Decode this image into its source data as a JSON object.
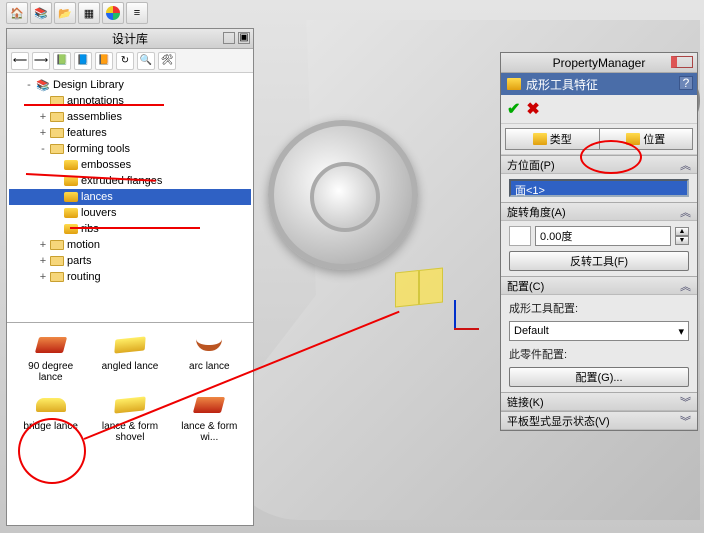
{
  "dl": {
    "title": "设计库",
    "root": "Design Library",
    "items": [
      {
        "indent": 1,
        "expand": "-",
        "icon": "lib",
        "label": "Design Library"
      },
      {
        "indent": 2,
        "expand": "",
        "icon": "fld",
        "label": "annotations"
      },
      {
        "indent": 2,
        "expand": "+",
        "icon": "fld",
        "label": "assemblies"
      },
      {
        "indent": 2,
        "expand": "+",
        "icon": "fld",
        "label": "features"
      },
      {
        "indent": 2,
        "expand": "-",
        "icon": "fld",
        "label": "forming tools"
      },
      {
        "indent": 3,
        "expand": "",
        "icon": "ft",
        "label": "embosses"
      },
      {
        "indent": 3,
        "expand": "",
        "icon": "ft",
        "label": "extruded flanges"
      },
      {
        "indent": 3,
        "expand": "",
        "icon": "ft",
        "label": "lances",
        "selected": true
      },
      {
        "indent": 3,
        "expand": "",
        "icon": "ft",
        "label": "louvers"
      },
      {
        "indent": 3,
        "expand": "",
        "icon": "ft",
        "label": "ribs"
      },
      {
        "indent": 2,
        "expand": "+",
        "icon": "fld",
        "label": "motion"
      },
      {
        "indent": 2,
        "expand": "+",
        "icon": "fld",
        "label": "parts"
      },
      {
        "indent": 2,
        "expand": "+",
        "icon": "fld",
        "label": "routing"
      }
    ],
    "thumbs": [
      {
        "label": "90 degree lance",
        "shape": "red"
      },
      {
        "label": "angled lance",
        "shape": "yel"
      },
      {
        "label": "arc lance",
        "shape": "cres"
      },
      {
        "label": "bridge lance",
        "shape": "bridge"
      },
      {
        "label": "lance & form shovel",
        "shape": "yel"
      },
      {
        "label": "lance & form wi...",
        "shape": "red"
      }
    ]
  },
  "pm": {
    "title": "PropertyManager",
    "feature": "成形工具特征",
    "tabs": {
      "type": "类型",
      "position": "位置"
    },
    "sections": {
      "placement": {
        "header": "方位面(P)",
        "face": "面<1>"
      },
      "rotation": {
        "header": "旋转角度(A)",
        "value": "0.00度",
        "reverse": "反转工具(F)"
      },
      "config": {
        "header": "配置(C)",
        "label1": "成形工具配置:",
        "default": "Default",
        "label2": "此零件配置:",
        "btn": "配置(G)..."
      },
      "link": {
        "header": "链接(K)"
      },
      "flat": {
        "header": "平板型式显示状态(V)"
      }
    }
  }
}
